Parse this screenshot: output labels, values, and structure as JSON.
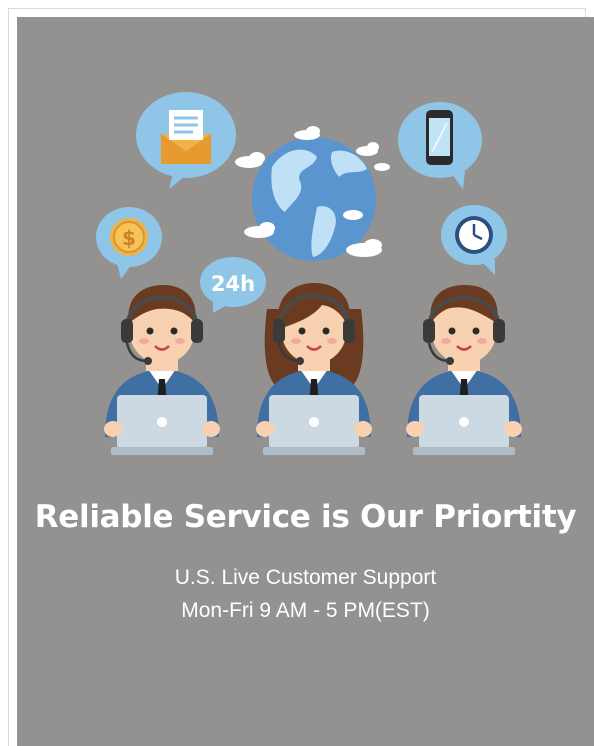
{
  "banner": {
    "headline": "Reliable Service is Our Priortity",
    "subline_1": "U.S. Live Customer Support",
    "subline_2": "Mon-Fri 9 AM - 5 PM(EST)",
    "badge_24h": "24h"
  },
  "colors": {
    "panel_background": "#939291",
    "bubble_blue": "#8fc6e8",
    "jacket_blue": "#3f6fa3",
    "headline_text": "#ffffff"
  },
  "icons": [
    "envelope-icon",
    "smartphone-icon",
    "coin-icon",
    "clock-icon",
    "globe-icon"
  ]
}
